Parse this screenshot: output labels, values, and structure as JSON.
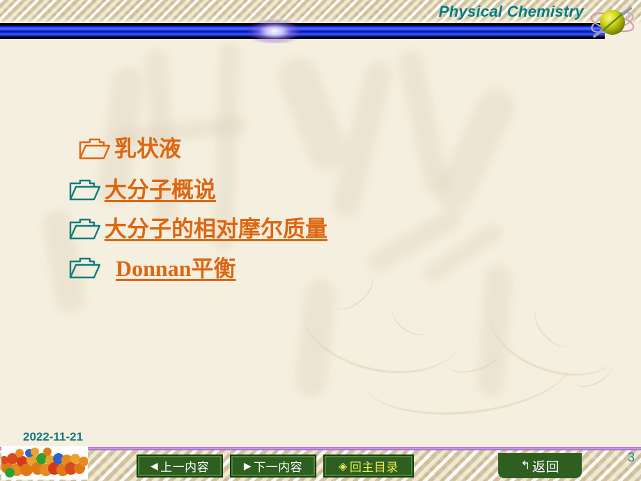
{
  "header": {
    "title": "Physical Chemistry",
    "logo_icon": "atom-icon"
  },
  "colors": {
    "slide_background": "#f5efdf",
    "header_title": "#007d7d",
    "accent_orange": "#dd6611",
    "accent_teal": "#0d7d7d",
    "footer_rule_purple": "#a96edb",
    "button_green": "#2e5e20",
    "button_highlight_yellow": "#ecec4f",
    "page_number_teal": "#0f8c8c"
  },
  "content": {
    "items": [
      {
        "label": "乳状液",
        "icon": "open-folder-icon",
        "icon_color": "#dd6611",
        "underlined": false,
        "serif_lead": false
      },
      {
        "label": "大分子概说",
        "icon": "open-folder-icon",
        "icon_color": "#0d7d7d",
        "underlined": true,
        "serif_lead": false
      },
      {
        "label": "大分子的相对摩尔质量",
        "icon": "open-folder-icon",
        "icon_color": "#0d7d7d",
        "underlined": true,
        "serif_lead": false
      },
      {
        "label": "Donnan平衡",
        "icon": "open-folder-icon",
        "icon_color": "#0d7d7d",
        "underlined": true,
        "serif_lead": true
      }
    ]
  },
  "footer": {
    "date": "2022-11-21",
    "page_number": "3",
    "molecule_thumbnail_icon": "space-filling-molecule-icon",
    "buttons": [
      {
        "id": "prev",
        "glyph": "◀",
        "glyph_icon": "triangle-left-icon",
        "label": "上一内容"
      },
      {
        "id": "next",
        "glyph": "▶",
        "glyph_icon": "triangle-right-icon",
        "label": "下一内容"
      },
      {
        "id": "home",
        "glyph": "◈",
        "glyph_icon": "diamond-icon",
        "label": "回主目录"
      },
      {
        "id": "back",
        "glyph": "↰",
        "glyph_icon": "return-arrow-icon",
        "label": "返回"
      }
    ]
  }
}
